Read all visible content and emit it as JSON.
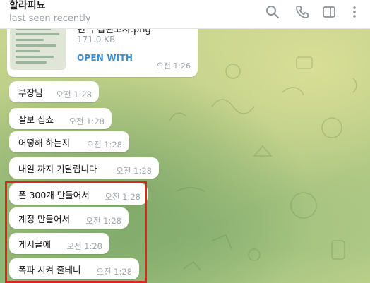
{
  "header": {
    "title": "할라피뇨",
    "status": "last seen recently",
    "icons": [
      "search-icon",
      "phone-icon",
      "sidebar-toggle-icon",
      "more-vertical-icon"
    ]
  },
  "file_message": {
    "name": "변 수집된고사.png",
    "size": "171.0 KB",
    "action": "OPEN WITH",
    "time": "오전 1:26"
  },
  "messages": [
    {
      "text": "부장님",
      "time": "오전 1:28"
    },
    {
      "text": "잘보 십쇼",
      "time": "오전 1:28"
    },
    {
      "text": "어떻해 하는지",
      "time": "오전 1:28"
    },
    {
      "text": "내일 까지 기달립니다",
      "time": "오전 1:28"
    },
    {
      "text": "폰 300개 만들어서",
      "time": "오전 1:28"
    },
    {
      "text": "계정 만들어서",
      "time": "오전 1:28"
    },
    {
      "text": "게시글에",
      "time": "오전 1:28"
    },
    {
      "text": "폭파 시켜 줄테니",
      "time": "오전 1:28"
    }
  ],
  "colors": {
    "highlight": "#e02424",
    "link": "#3a8fd6",
    "bubble": "#ffffff"
  }
}
